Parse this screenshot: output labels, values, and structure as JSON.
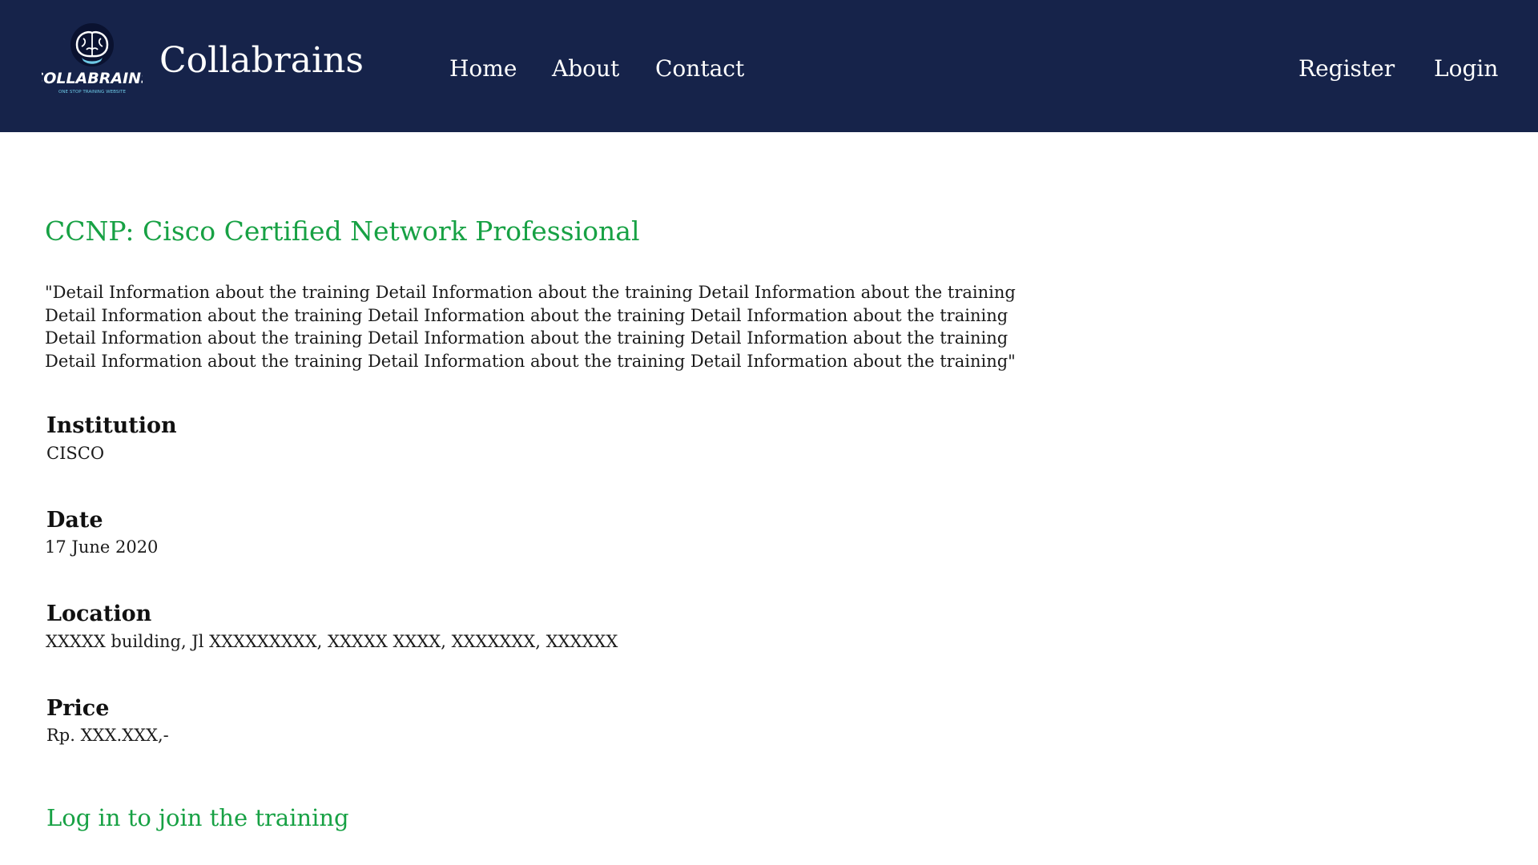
{
  "header": {
    "logo": {
      "wordmark": "COLLABRAINS",
      "tagline": "ONE STOP TRAINING WEBSITE",
      "icon": "brain-icon"
    },
    "brand_name": "Collabrains",
    "nav": {
      "home": "Home",
      "about": "About",
      "contact": "Contact"
    },
    "auth": {
      "register": "Register",
      "login": "Login"
    }
  },
  "training": {
    "title": "CCNP: Cisco Certified Network Professional",
    "description_lines": [
      "\"Detail Information about the training Detail Information about the training Detail Information about the training",
      "Detail Information about the training Detail Information about the training Detail Information about the training",
      "Detail Information about the training Detail Information about the training Detail Information about the training",
      "Detail Information about the training Detail Information about the training Detail Information about the training\""
    ],
    "institution": {
      "label": "Institution",
      "value": "CISCO"
    },
    "date": {
      "label": "Date",
      "value": "17 June 2020"
    },
    "location": {
      "label": "Location",
      "value": "XXXXX building, Jl XXXXXXXXX, XXXXX XXXX, XXXXXXX, XXXXXX"
    },
    "price": {
      "label": "Price",
      "value": "Rp. XXX.XXX,-"
    },
    "join_link": "Log in to join the training"
  },
  "colors": {
    "navbar": "#16234a",
    "accent_green": "#17a144",
    "text": "#1a1a1a"
  }
}
